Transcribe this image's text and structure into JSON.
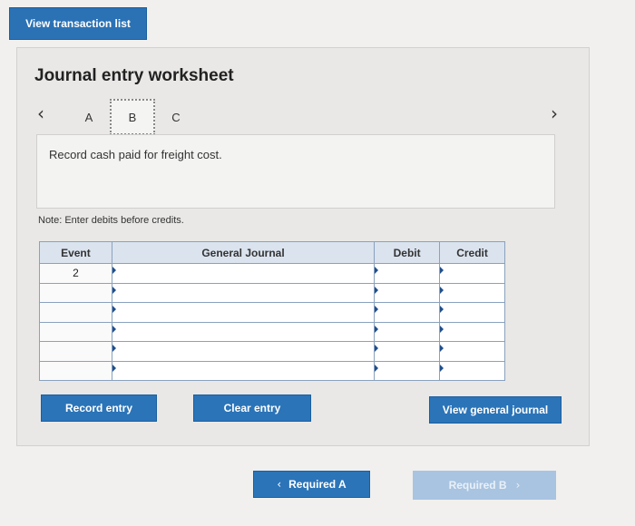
{
  "top_button": {
    "label": "View transaction list"
  },
  "worksheet": {
    "title": "Journal entry worksheet",
    "tabs": [
      {
        "label": "A"
      },
      {
        "label": "B",
        "active": true
      },
      {
        "label": "C"
      }
    ],
    "description": "Record cash paid for freight cost.",
    "note": "Note: Enter debits before credits."
  },
  "table": {
    "headers": {
      "event": "Event",
      "general_journal": "General Journal",
      "debit": "Debit",
      "credit": "Credit"
    },
    "rows": [
      {
        "event": "2",
        "account": "",
        "debit": "",
        "credit": ""
      },
      {
        "event": "",
        "account": "",
        "debit": "",
        "credit": ""
      },
      {
        "event": "",
        "account": "",
        "debit": "",
        "credit": ""
      },
      {
        "event": "",
        "account": "",
        "debit": "",
        "credit": ""
      },
      {
        "event": "",
        "account": "",
        "debit": "",
        "credit": ""
      },
      {
        "event": "",
        "account": "",
        "debit": "",
        "credit": ""
      }
    ]
  },
  "actions": {
    "record_entry": "Record entry",
    "clear_entry": "Clear entry",
    "view_general_journal": "View general journal"
  },
  "footer": {
    "required_a": "Required A",
    "required_b": "Required B",
    "prev_icon": "chevron-left-icon",
    "next_icon": "chevron-right-icon"
  },
  "colors": {
    "primary": "#2b74b8",
    "disabled": "#a9c4e0",
    "table_header": "#dbe3ee"
  }
}
